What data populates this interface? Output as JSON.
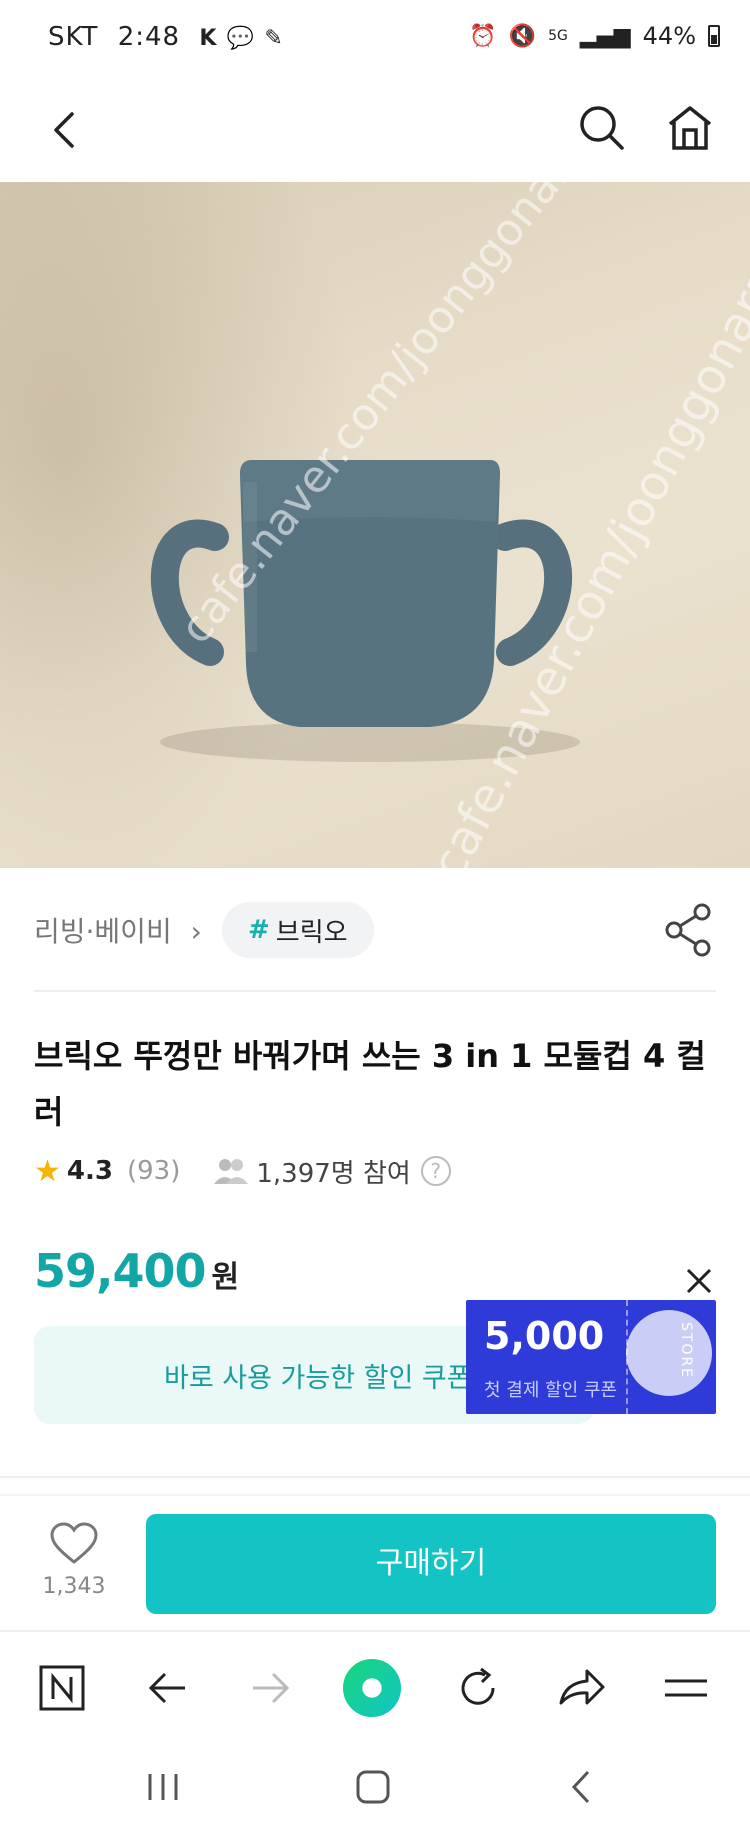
{
  "status_bar": {
    "carrier": "SKT",
    "time": "2:48",
    "battery": "44%"
  },
  "photo": {
    "watermark_1": "cafe.naver.com/joonggonara",
    "watermark_2": "cafe.naver.com/joonggonara"
  },
  "category": {
    "path": "리빙·베이비",
    "tag_hash": "#",
    "tag": "브릭오"
  },
  "product": {
    "title": "브릭오 뚜껑만 바꿔가며 쓰는 3 in 1 모듈컵 4 컬러",
    "rating": "4.3",
    "review_count": "(93)",
    "participants": "1,397명 참여",
    "help": "?"
  },
  "price": {
    "amount": "59,400",
    "unit": "원"
  },
  "coupon": {
    "banner_text": "바로 사용 가능한 할인 쿠폰",
    "card_amount": "5,000",
    "card_subtitle": "첫 결제 할인 쿠폰",
    "card_side_label": "STORE"
  },
  "action": {
    "like_count": "1,343",
    "buy_label": "구매하기"
  },
  "colors": {
    "accent": "#14c3c3",
    "price": "#13a6a6",
    "coupon_card": "#2f3bd8"
  }
}
